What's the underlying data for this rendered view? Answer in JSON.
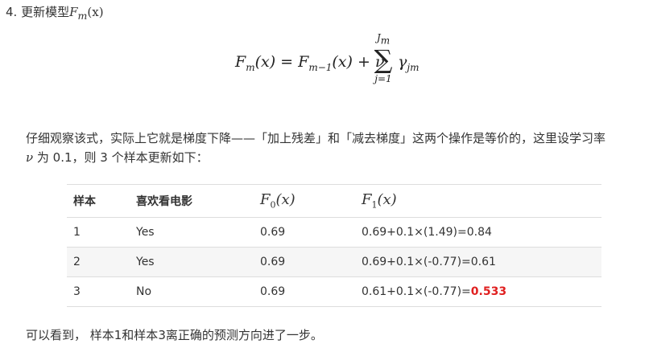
{
  "step": {
    "number": "4.",
    "text": "更新模型",
    "symbol": "F",
    "subscript": "m",
    "arg": "(x)"
  },
  "formula": {
    "lhs": "F",
    "lhs_sub": "m",
    "lhs_arg": "(x) = ",
    "rhs_f": "F",
    "rhs_f_sub": "m−1",
    "rhs_f_arg": "(x) + ν",
    "sum_upper": "J",
    "sum_upper_sub": "m",
    "sum_symbol": "∑",
    "sum_lower": "j=1",
    "gamma": "γ",
    "gamma_sub": "jm"
  },
  "paragraph": {
    "line1": "仔细观察该式，实际上它就是梯度下降——「加上残差」和「减去梯度」这两个操作是等价的，这里设学习率",
    "nu": "ν",
    "line2": " 为 0.1，则 3 个样本更新如下："
  },
  "table": {
    "headers": [
      "样本",
      "喜欢看电影"
    ],
    "math_headers": [
      {
        "symbol": "F",
        "sub": "0",
        "arg": "(x)"
      },
      {
        "symbol": "F",
        "sub": "1",
        "arg": "(x)"
      }
    ],
    "rows": [
      {
        "sample": "1",
        "likes": "Yes",
        "f0": "0.69",
        "f1": "0.69+0.1×(1.49)=0.84",
        "f1_suffix": ""
      },
      {
        "sample": "2",
        "likes": "Yes",
        "f0": "0.69",
        "f1": "0.69+0.1×(-0.77)=0.61",
        "f1_suffix": ""
      },
      {
        "sample": "3",
        "likes": "No",
        "f0": "0.69",
        "f1": "0.61+0.1×(-0.77)=",
        "f1_suffix": "0.533"
      }
    ]
  },
  "conclusion": "可以看到， 样本1和样本3离正确的预测方向进了一步。"
}
